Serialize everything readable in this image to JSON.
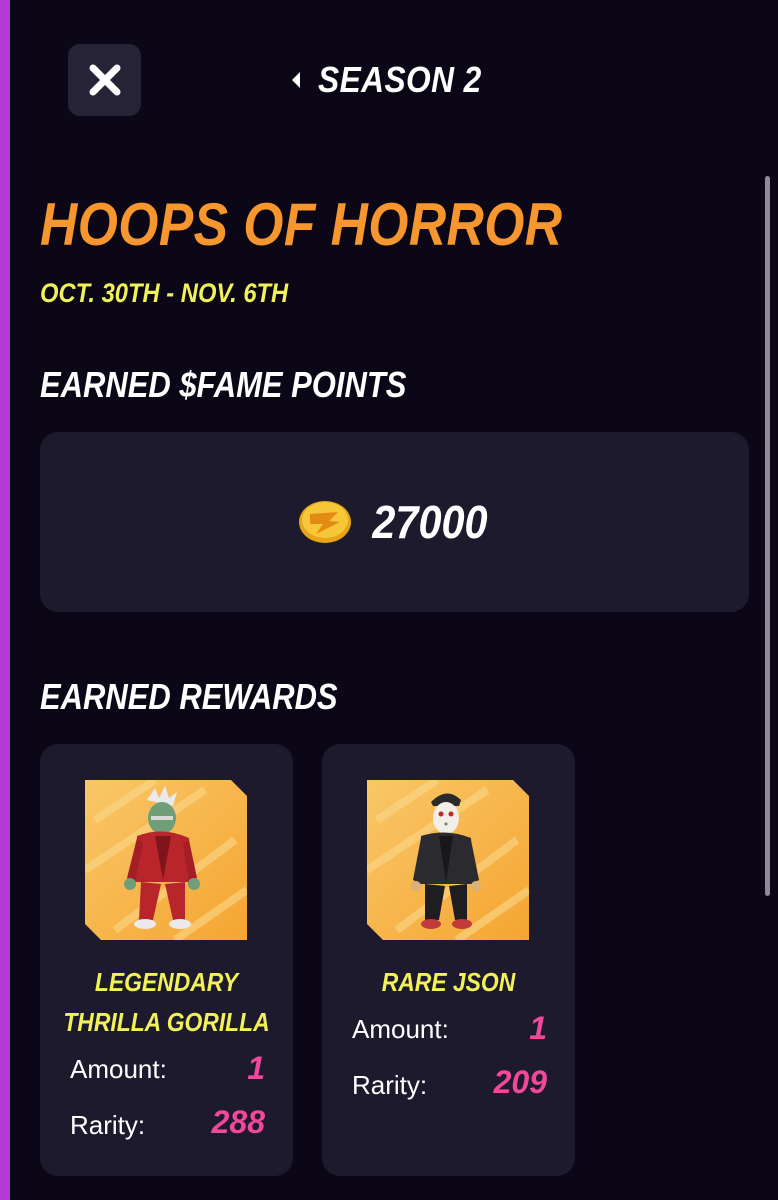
{
  "header": {
    "close_icon": "close-icon",
    "back_icon": "caret-left-icon",
    "season_label": "SEASON 2"
  },
  "event": {
    "title": "HOOPS OF HORROR",
    "dates": "OCT. 30TH - NOV. 6TH"
  },
  "points": {
    "heading": "EARNED $FAME POINTS",
    "coin_icon": "fame-coin-icon",
    "value": "27000"
  },
  "rewards": {
    "heading": "EARNED REWARDS",
    "items": [
      {
        "name": "LEGENDARY THRILLA GORILLA",
        "amount_label": "Amount:",
        "amount": "1",
        "rarity_label": "Rarity:",
        "rarity": "288",
        "image_icon": "zombie-character-icon"
      },
      {
        "name": "RARE JSON",
        "amount_label": "Amount:",
        "amount": "1",
        "rarity_label": "Rarity:",
        "rarity": "209",
        "image_icon": "masked-character-icon"
      }
    ]
  },
  "colors": {
    "background": "#0b0717",
    "card": "#1e1a2d",
    "title_orange": "#f6962f",
    "date_yellow": "#f1f15a",
    "value_pink": "#f0489a",
    "accent_purple": "#b43ad8"
  }
}
